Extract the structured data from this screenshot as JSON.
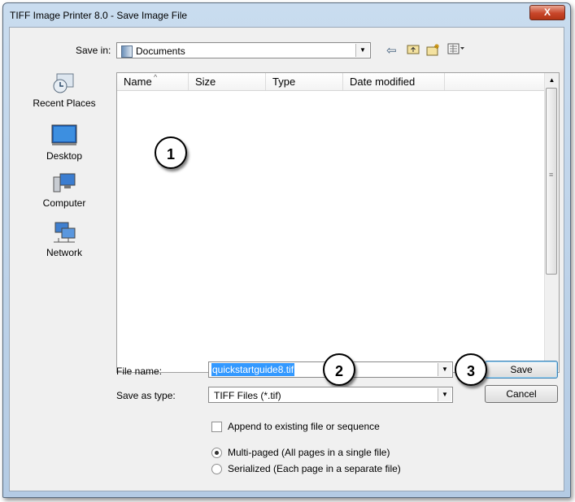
{
  "window": {
    "title": "TIFF Image Printer 8.0 - Save Image File",
    "close_label": "X"
  },
  "save_in": {
    "label": "Save in:",
    "value": "Documents"
  },
  "toolbar_icons": [
    "back-arrow-icon",
    "up-folder-icon",
    "new-folder-icon",
    "view-menu-icon"
  ],
  "places": [
    {
      "label": "Recent Places",
      "icon": "recent-places-icon"
    },
    {
      "label": "Desktop",
      "icon": "desktop-icon"
    },
    {
      "label": "Computer",
      "icon": "computer-icon"
    },
    {
      "label": "Network",
      "icon": "network-icon"
    }
  ],
  "file_list": {
    "columns": [
      "Name",
      "Size",
      "Type",
      "Date modified"
    ],
    "rows": []
  },
  "file_name": {
    "label": "File name:",
    "value": "quickstartguide8.tif"
  },
  "save_as_type": {
    "label": "Save as type:",
    "value": "TIFF Files (*.tif)"
  },
  "buttons": {
    "save": "Save",
    "cancel": "Cancel"
  },
  "append_option": {
    "label": "Append to existing file or sequence",
    "checked": false
  },
  "page_options": [
    {
      "label": "Multi-paged (All pages in a single file)",
      "selected": true
    },
    {
      "label": "Serialized (Each page in a separate file)",
      "selected": false
    }
  ],
  "callouts": [
    "1",
    "2",
    "3"
  ],
  "colors": {
    "selection": "#3399ff",
    "titlebar": "#c9dcef",
    "close": "#c8462a"
  }
}
